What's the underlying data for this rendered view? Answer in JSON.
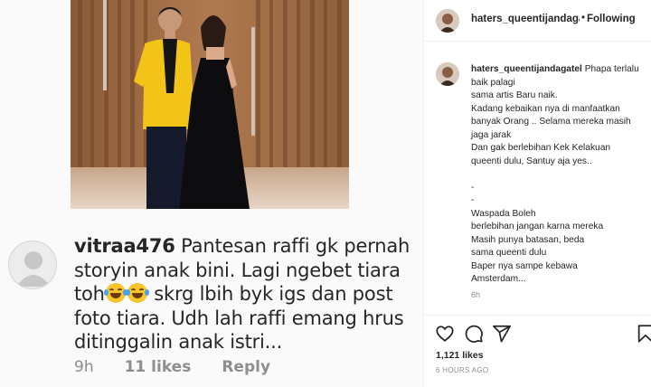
{
  "comment": {
    "username": "vitraa476",
    "text_parts": [
      "Pantesan raffi gk pernah storyin anak bini. Lagi ngebet tiara toh",
      "skrg lbih byk igs dan post foto tiara. Udh lah raffi emang hrus ditinggalin  anak istri..."
    ],
    "emoji_names": [
      "face-with-tears-of-joy-icon",
      "face-with-tears-of-joy-icon"
    ],
    "time": "9h",
    "likes": "11 likes",
    "reply": "Reply"
  },
  "post": {
    "username": "haters_queentijandagatel",
    "username_short": "haters_queentijandaga",
    "dot": "•",
    "follow_label": "Following",
    "caption_lines": [
      "Phapa terlalu baik palagi",
      "sama artis Baru naik.",
      "Kadang kebaikan nya di manfaatkan banyak Orang .. Selama mereka masih jaga jarak",
      "Dan gak berlebihan Kek Kelakuan queenti dulu, Santuy aja yes..",
      "",
      "-",
      "-",
      "Waspada Boleh",
      "berlebihan jangan karna mereka",
      "Masih punya batasan, beda",
      "sama queenti dulu",
      "Baper nya sampe kebawa",
      "Amsterdam..."
    ],
    "caption_time": "6h",
    "likes": "1,121 likes",
    "time": "6 HOURS AGO"
  },
  "icons": {
    "like": "heart-icon",
    "comment": "comment-bubble-icon",
    "share": "paper-plane-icon",
    "save": "bookmark-icon"
  },
  "colors": {
    "text": "#262626",
    "muted": "#8e8e8e",
    "border": "#efefef",
    "jacket": "#f2c418"
  }
}
